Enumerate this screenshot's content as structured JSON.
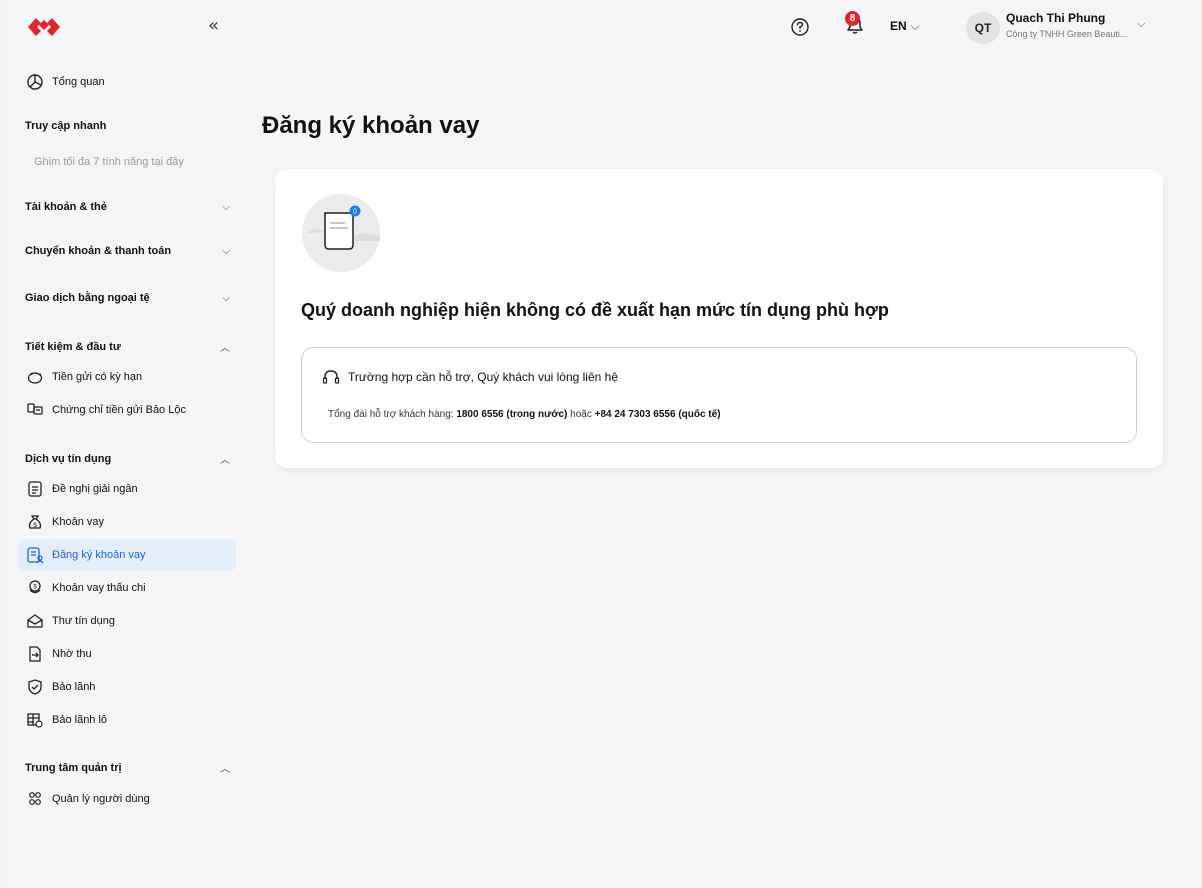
{
  "header": {
    "collapse_label": "«",
    "notifications_count": "8",
    "language": "EN",
    "user": {
      "initials": "QT",
      "name": "Quach Thi Phung",
      "company": "Công ty TNHH Green Beauti..."
    }
  },
  "sidebar": {
    "overview": "Tổng quan",
    "quick_access": {
      "title": "Truy cập nhanh",
      "hint": "Ghim tối đa 7 tính năng tại đây"
    },
    "groups": {
      "accounts": "Tài khoản & thẻ",
      "transfers": "Chuyển khoản & thanh toán",
      "fx": "Giao dịch bằng ngoại tệ",
      "savings": "Tiết kiệm & đầu tư",
      "credit": "Dịch vụ tín dụng",
      "admin": "Trung tâm quản trị"
    },
    "savings_items": [
      "Tiền gửi có kỳ hạn",
      "Chứng chỉ tiền gửi Bảo Lộc"
    ],
    "credit_items": [
      "Đề nghị giải ngân",
      "Khoản vay",
      "Đăng ký khoản vay",
      "Khoản vay thấu chi",
      "Thư tín dụng",
      "Nhờ thu",
      "Bảo lãnh",
      "Bảo lãnh lô"
    ],
    "admin_items": [
      "Quản lý người dùng"
    ],
    "active_item": "Đăng ký khoản vay"
  },
  "main": {
    "title": "Đăng ký khoản vay",
    "message": "Quý doanh nghiệp hiện không có đề xuất hạn mức tín dụng phù hợp",
    "support": {
      "title": "Trường hợp cần hỗ trợ, Quý khách vui lòng liên hệ",
      "prefix": "Tổng đài hỗ trợ khách hàng: ",
      "domestic": "1800 6556 (trong nước)",
      "connector": " hoặc ",
      "international": "+84 24 7303 6556 (quốc tế)"
    },
    "illustration_badge": "0"
  },
  "colors": {
    "brand": "#e0252f",
    "accent": "#1f63d6",
    "active_bg": "#e4eefb"
  }
}
